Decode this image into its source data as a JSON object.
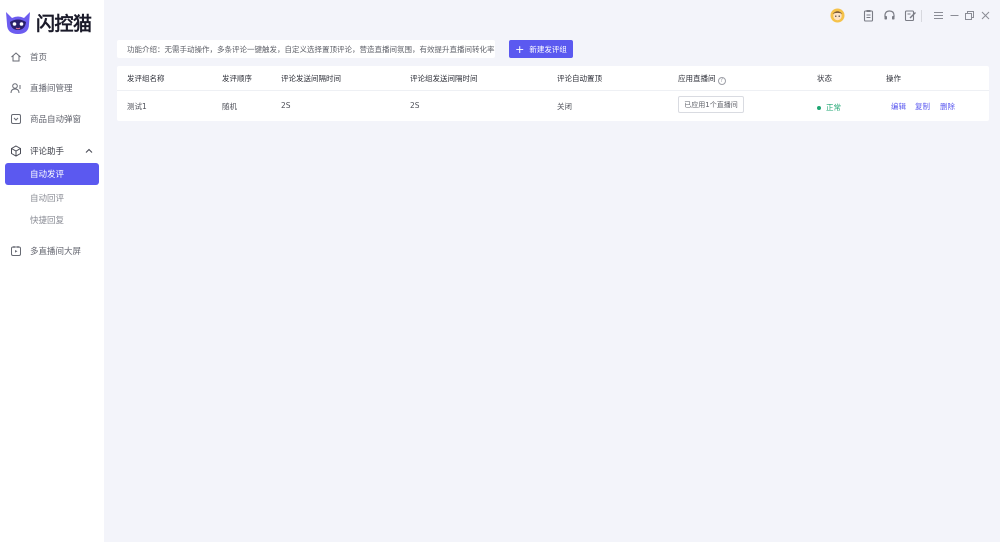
{
  "app": {
    "name": "闪控猫"
  },
  "sidebar": {
    "items": [
      {
        "label": "首页",
        "icon": "home-icon"
      },
      {
        "label": "直播间管理",
        "icon": "user-icon"
      },
      {
        "label": "商品自动弹窗",
        "icon": "popup-icon"
      },
      {
        "label": "评论助手",
        "icon": "cube-icon",
        "expanded": true
      },
      {
        "label": "多直播间大屏",
        "icon": "screen-icon"
      }
    ],
    "sub_items": [
      {
        "label": "自动发评",
        "active": true
      },
      {
        "label": "自动回评",
        "active": false
      },
      {
        "label": "快捷回复",
        "active": false
      }
    ]
  },
  "toolbar": {
    "icons": [
      "avatar-icon",
      "clipboard-icon",
      "headset-icon",
      "edit-icon",
      "menu-icon",
      "minimize-icon",
      "restore-icon",
      "close-icon"
    ]
  },
  "intro": {
    "text": "功能介绍：无需手动操作，多条评论一键触发，自定义选择置顶评论，营造直播间氛围，有效提升直播间转化率"
  },
  "new_button": {
    "label": "新建发评组"
  },
  "table": {
    "headers": [
      "发评组名称",
      "发评顺序",
      "评论发送间隔时间",
      "评论组发送间隔时间",
      "评论自动置顶",
      "应用直播间",
      "状态",
      "操作"
    ],
    "rows": [
      {
        "name": "测试1",
        "order": "随机",
        "comment_interval": "2S",
        "group_interval": "2S",
        "auto_pin": "关闭",
        "rooms": "已应用1个直播间",
        "status": "正常",
        "actions": [
          "编辑",
          "复制",
          "删除"
        ]
      }
    ]
  },
  "colors": {
    "accent": "#5b59f0",
    "status_ok": "#1ea672",
    "background": "#f3f4fa"
  }
}
